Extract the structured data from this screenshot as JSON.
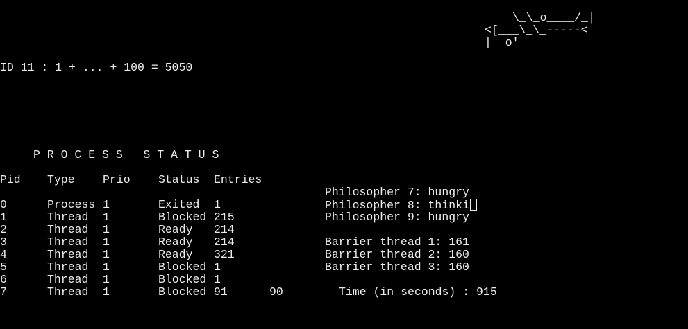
{
  "ascii_art": {
    "line1": "\\_\\_o____/_|",
    "line2": "<[___\\_\\_-----<",
    "line3": "|  o'"
  },
  "sum_output": "ID 11 : 1 + ... + 100 = 5050",
  "process_status": {
    "title": "P R O C E S S   S T A T U S",
    "headers": {
      "pid": "Pid",
      "type": "Type",
      "prio": "Prio",
      "status": "Status",
      "entries": "Entries"
    },
    "rows": [
      {
        "pid": "0",
        "type": "Process",
        "prio": "1",
        "status": "Exited",
        "entries": "1"
      },
      {
        "pid": "1",
        "type": "Thread",
        "prio": "1",
        "status": "Blocked",
        "entries": "215"
      },
      {
        "pid": "2",
        "type": "Thread",
        "prio": "1",
        "status": "Ready",
        "entries": "214"
      },
      {
        "pid": "3",
        "type": "Thread",
        "prio": "1",
        "status": "Ready",
        "entries": "214"
      },
      {
        "pid": "4",
        "type": "Thread",
        "prio": "1",
        "status": "Ready",
        "entries": "321"
      },
      {
        "pid": "5",
        "type": "Thread",
        "prio": "1",
        "status": "Blocked",
        "entries": "1"
      },
      {
        "pid": "6",
        "type": "Thread",
        "prio": "1",
        "status": "Blocked",
        "entries": "1"
      },
      {
        "pid": "7",
        "type": "Thread",
        "prio": "1",
        "status": "Blocked",
        "entries": "91"
      }
    ],
    "extra_value": "90"
  },
  "philosophers": [
    "Philosopher 7: hungry",
    "Philosopher 8: thinki",
    "Philosopher 9: hungry"
  ],
  "barriers": [
    "Barrier thread 1: 161",
    "Barrier thread 2: 160",
    "Barrier thread 3: 160"
  ],
  "timer": "Time (in seconds) : 915",
  "colors": {
    "background": "#000000",
    "text": "#ececec"
  }
}
